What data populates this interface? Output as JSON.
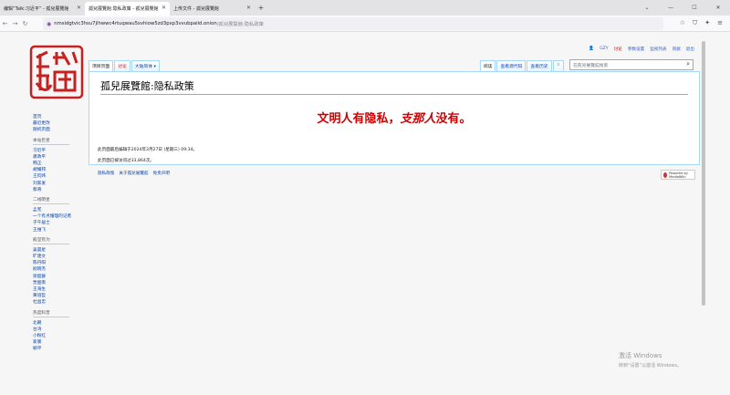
{
  "browser": {
    "tabs": [
      {
        "label": "编辑“Talk:习近平” - 孤兒展覽館",
        "active": false
      },
      {
        "label": "孤兒展覽館:隐私政策 - 孤兒展覽館",
        "active": true
      },
      {
        "label": "上传文件 - 孤兒展覽館",
        "active": false
      }
    ],
    "new_tab": "+",
    "url_host": "nmsidgtvic3hsu7jlhwwc4rtuqwau5svhiow5zd3pxp3vvubpaiid.onion",
    "url_path": "/孤兒展覽館:隐私政策"
  },
  "personal": {
    "user": "GZY",
    "talk": "讨论",
    "prefs": "参数设置",
    "watchlist": "监视列表",
    "contribs": "贡献",
    "logout": "退出"
  },
  "page_tabs": {
    "project": "项目页面",
    "talk": "讨论",
    "variant": "大陆简体"
  },
  "view_tabs": {
    "read": "阅读",
    "source": "查看源代码",
    "history": "查看历史"
  },
  "search": {
    "placeholder": "在孤兒展覽館搜索"
  },
  "content": {
    "title": "孤兒展覽館:隐私政策",
    "headline_a": "文明人有隐私，",
    "headline_b": "支那人",
    "headline_c": "没有。"
  },
  "footer": {
    "last_edit": "此页面最后编辑于2024年3月27日 (星期三) 09:34。",
    "views": "此页面已被访问过33,864次。",
    "links": [
      "隐私政策",
      "关于孤兒展覽館",
      "免责声明"
    ],
    "powered": "Powered by MediaWiki"
  },
  "sidebar": {
    "main": [
      "首页",
      "最近更改",
      "随机页面"
    ],
    "sections": [
      {
        "head": "本站巨星",
        "items": [
          "习近平",
          "裘政平",
          "韩正",
          "胡耀邦",
          "王钧炜",
          "刘家发",
          "蔡奇"
        ]
      },
      {
        "head": "二线明星",
        "items": [
          "孟宪",
          "一个有点懂理的记者",
          "子午居士",
          "王维飞"
        ]
      },
      {
        "head": "殿堂有为",
        "items": [
          "吴晨星",
          "旷建文",
          "陈丹阳",
          "刚晓杰",
          "梁超群",
          "贾图南",
          "王海生",
          "黄培哲",
          "杜昌忠"
        ]
      },
      {
        "head": "热度科普",
        "items": [
          "北朝",
          "台湾",
          "小粉红",
          "家暴",
          "躺平"
        ]
      }
    ]
  },
  "watermark": {
    "line1": "激活 Windows",
    "line2": "转到“设置”以激活 Windows。"
  },
  "colors": {
    "headline": "#d20000",
    "link": "#0645ad"
  }
}
